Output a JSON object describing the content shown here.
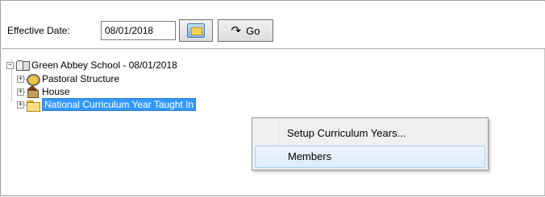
{
  "toolbar": {
    "effective_date_label": "Effective Date:",
    "effective_date_value": "08/01/2018",
    "go_label": "Go",
    "calendar_icon": "calendar-icon",
    "go_icon": "go-arrow-icon"
  },
  "tree": {
    "root": {
      "label": "Green Abbey School - 08/01/2018",
      "expander": "−",
      "icon": "school-icon"
    },
    "children": [
      {
        "label": "Pastoral Structure",
        "expander": "+",
        "icon": "pastoral-icon"
      },
      {
        "label": "House",
        "expander": "+",
        "icon": "house-icon"
      },
      {
        "label": "National Curriculum Year Taught In",
        "expander": "+",
        "icon": "folder-icon",
        "selected": true
      }
    ]
  },
  "context_menu": {
    "items": [
      {
        "label": "Setup Curriculum Years..."
      },
      {
        "label": "Members",
        "highlighted": true
      }
    ]
  },
  "colors": {
    "selection": "#3399ff",
    "menu_bg": "#f0f0f0",
    "menu_hover": "#dcebfc"
  }
}
